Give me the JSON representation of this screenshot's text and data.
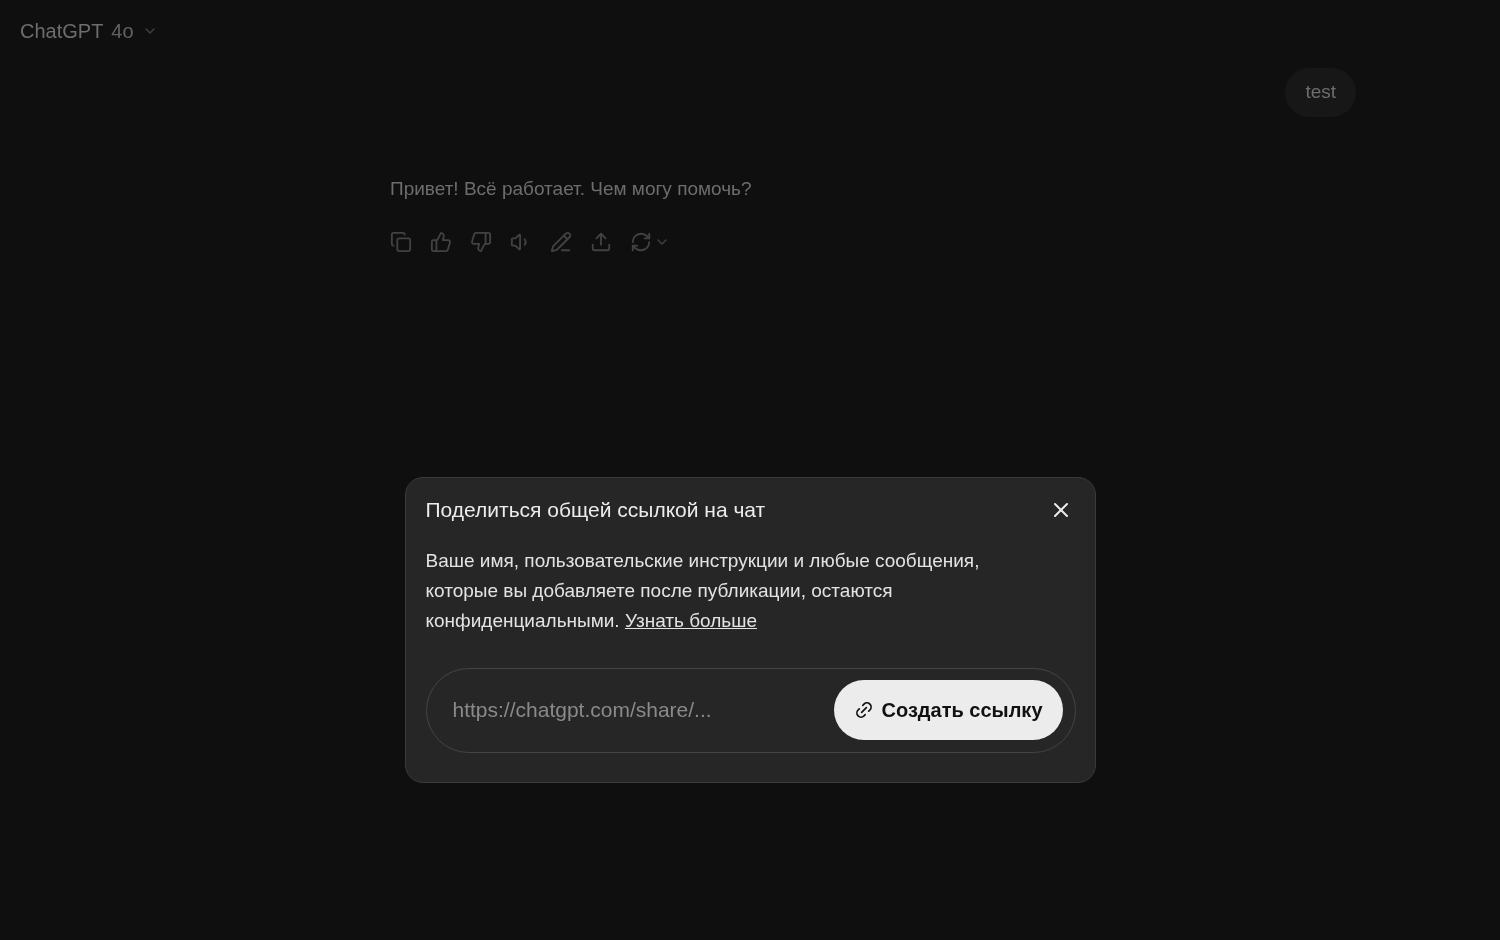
{
  "header": {
    "title": "ChatGPT",
    "model": "4o"
  },
  "messages": [
    {
      "kind": "user",
      "text": "test"
    },
    {
      "kind": "assistant",
      "text": "Привет! Всё работает. Чем могу помочь?"
    }
  ],
  "dialog": {
    "title": "Поделиться общей ссылкой на чат",
    "description": {
      "text": "Ваше имя, пользовательские инструкции и любые сообщения, которые вы добавляете после публикации, остаются конфиденциальными.",
      "link": "Узнать больше"
    },
    "link_field": {
      "placeholder": "https://chatgpt.com/share/..."
    },
    "create_button": "Создать ссылку"
  }
}
